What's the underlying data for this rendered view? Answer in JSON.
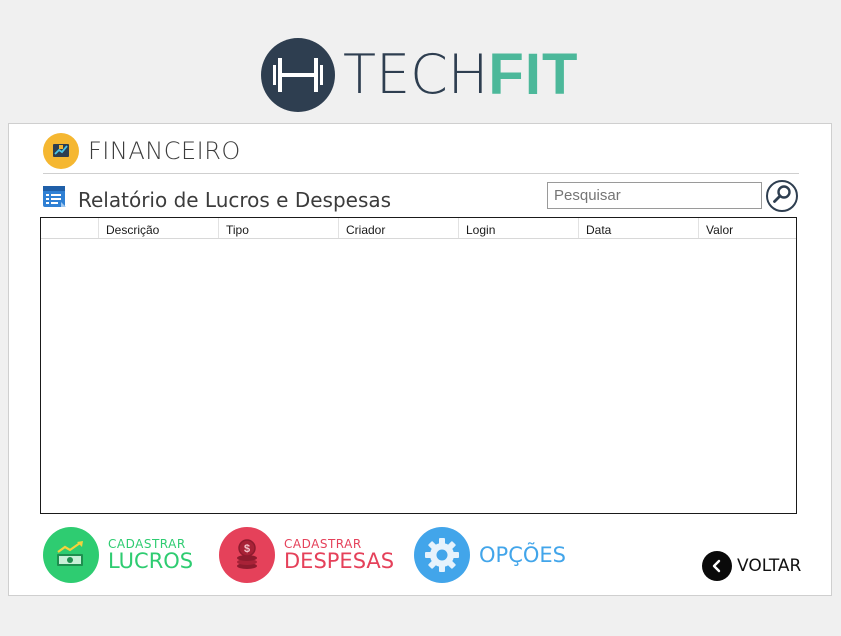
{
  "logo": {
    "part1": "TECH",
    "part2": "FIT",
    "colors": {
      "dark": "#2e3e50",
      "accent": "#4cb89a"
    }
  },
  "section": {
    "title": "FINANCEIRO",
    "icon": "finance-chart-icon"
  },
  "report": {
    "title": "Relatório de Lucros e Despesas",
    "icon": "report-list-icon"
  },
  "search": {
    "placeholder": "Pesquisar",
    "icon": "magnifier-icon"
  },
  "grid": {
    "columns": [
      "Descrição",
      "Tipo",
      "Criador",
      "Login",
      "Data",
      "Valor"
    ],
    "rows": []
  },
  "actions": {
    "lucros": {
      "small": "CADASTRAR",
      "big": "LUCROS",
      "color": "#2ecc71",
      "icon": "money-growth-icon"
    },
    "despesas": {
      "small": "CADASTRAR",
      "big": "DESPESAS",
      "color": "#e5415a",
      "icon": "coins-stack-icon"
    },
    "opcoes": {
      "big": "OPÇÕES",
      "color": "#42a5ea",
      "icon": "gear-icon"
    }
  },
  "voltar": {
    "label": "VOLTAR",
    "icon": "chevron-left-icon"
  }
}
